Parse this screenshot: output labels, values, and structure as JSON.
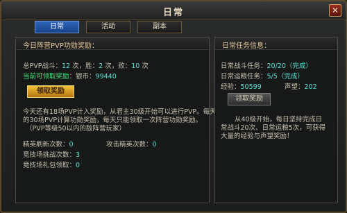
{
  "window": {
    "title": "日常",
    "close": "✕"
  },
  "tabs": [
    {
      "label": "日常",
      "active": true
    },
    {
      "label": "活动",
      "active": false
    },
    {
      "label": "副本",
      "active": false
    }
  ],
  "left": {
    "header": "今日阵营PVP功勋奖励：",
    "pvp_label": "总PVP战斗：",
    "pvp_total": "12",
    "pvp_win_label": "次，胜：",
    "pvp_win": "2",
    "pvp_lose_label": "次，败：",
    "pvp_lose": "10",
    "pvp_unit": "次",
    "reward_label": "当前可领取奖励：",
    "reward_type": "银币：",
    "reward_value": "99440",
    "claim_button": "领取奖励",
    "desc_line1": "今天还有18场PVP计入奖励，从君主30级开始可以进行PVP。每天",
    "desc_line2": "的30场PVP计算功勋奖励，每天只能领取一次阵营功勋奖励。",
    "desc_line3": "（PVP等级50以内的敌阵营玩家）",
    "elite_refresh_label": "精英刷新次数：",
    "elite_refresh_value": "0",
    "elite_attack_label": "攻击精英次数：",
    "elite_attack_value": "0",
    "arena_challenge_label": "竞技场挑战次数：",
    "arena_challenge_value": "3",
    "arena_gift_label": "竞技场礼包领取：",
    "arena_gift_value": "0"
  },
  "right": {
    "header": "日常任务信息：",
    "battle_task_label": "日常战斗任务：",
    "battle_task_value": "20/20",
    "battle_task_status": "（完成）",
    "transport_task_label": "日常运粮任务：",
    "transport_task_value": "5/5",
    "transport_task_status": "（完成）",
    "exp_label": "经验：",
    "exp_value": "50599",
    "prestige_label": "声望：",
    "prestige_value": "202",
    "claim_button": "领取奖励",
    "note_line1": "从40级开始，每日坚持完成日",
    "note_line2": "常战斗20次、日常运粮5次，可获得",
    "note_line3": "大量的经验与声望奖励！"
  }
}
